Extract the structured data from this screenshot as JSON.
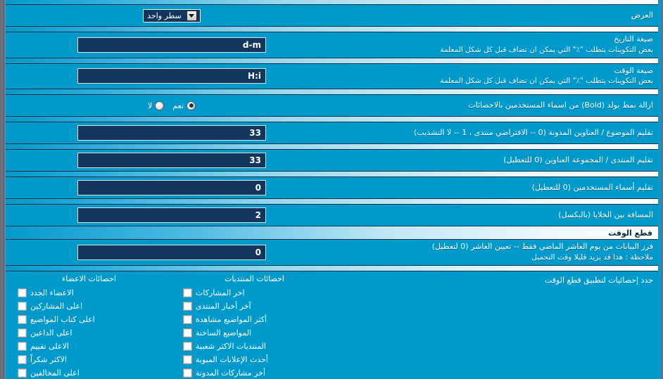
{
  "window": {
    "accent_cyan": "#0099cc",
    "field_navy": "#14355c",
    "frame_gray": "#6b7078"
  },
  "settings": [
    {
      "id": "display",
      "label": "العرض",
      "desc": "",
      "control": "select",
      "value": "سطر واحد"
    },
    {
      "id": "date-format",
      "label": "صيغة التاريخ",
      "desc": "بعض التكوينات يتطلب \"٪\" التي يمكن ان تضاف قبل كل شكل المعلمة",
      "control": "text",
      "value": "d-m"
    },
    {
      "id": "time-format",
      "label": "صيغة الوقت",
      "desc": "بعض التكوينات يتطلب \"٪\" التي يمكن ان تضاف قبل كل شكل المعلمة",
      "control": "text",
      "value": "H:i"
    },
    {
      "id": "remove-bold",
      "label": "ازالة نمط بولد (Bold) من اسماء المستخدمين بالاحصائات",
      "desc": "",
      "control": "radio",
      "value": "نعم"
    },
    {
      "id": "trim-topic-title",
      "label": "تقليم الموضوع / العناوين المدونة (0 -- الافتراضي منتدى ، 1 -- لا التشذيب)",
      "desc": "",
      "control": "text",
      "value": "33"
    },
    {
      "id": "trim-forum-title",
      "label": "تقليم المنتدى / المجموعة العناوين (0 للتعطيل)",
      "desc": "",
      "control": "text",
      "value": "33"
    },
    {
      "id": "trim-usernames",
      "label": "تقليم أسماء المستخدمين (0 للتعطيل)",
      "desc": "",
      "control": "text",
      "value": "0"
    },
    {
      "id": "cell-spacing",
      "label": "المسافة بين الخلايا (بالبكسل)",
      "desc": "",
      "control": "text",
      "value": "2"
    }
  ],
  "section": {
    "title": "قطع الوقت"
  },
  "cutoff": {
    "label": "فرز البيانات من يوم العاشر الماضي فقط -- تعيين العاشر (0 لتعطيل)",
    "desc": "ملاحظة : هذا قد يزيد قليلا وقت التحميل",
    "value": "0"
  },
  "matrix": {
    "label": "حدد إحصائيات لتطبيق قطع الوقت",
    "columns": [
      {
        "id": "forum-stats",
        "header": "احصائات المنتديات",
        "items": [
          {
            "label": "اخر المشاركات",
            "checked": false
          },
          {
            "label": "آخر أخبار المنتدى",
            "checked": false
          },
          {
            "label": "أكثر المواضيع مشاهدة",
            "checked": false
          },
          {
            "label": "المواضيع الساخنة",
            "checked": false
          },
          {
            "label": "المنتديات الاكثر شعبية",
            "checked": false
          },
          {
            "label": "أحدث الإعلانات المبوبة",
            "checked": false
          },
          {
            "label": "أخر مشاركات المدونة",
            "checked": false
          }
        ]
      },
      {
        "id": "member-stats",
        "header": "احصائات الاعضاء",
        "items": [
          {
            "label": "الاعضاء الجدد",
            "checked": false
          },
          {
            "label": "اعلى المشاركين",
            "checked": false
          },
          {
            "label": "اعلى كتاب المواضيع",
            "checked": false
          },
          {
            "label": "اعلى الداعين",
            "checked": false
          },
          {
            "label": "الاعلى تقييم",
            "checked": false
          },
          {
            "label": "الاكثر شكراً",
            "checked": false
          },
          {
            "label": "اعلى المخالفين",
            "checked": false
          }
        ]
      }
    ]
  },
  "icons": {
    "dropdown_arrow": "chevron-down-icon"
  }
}
